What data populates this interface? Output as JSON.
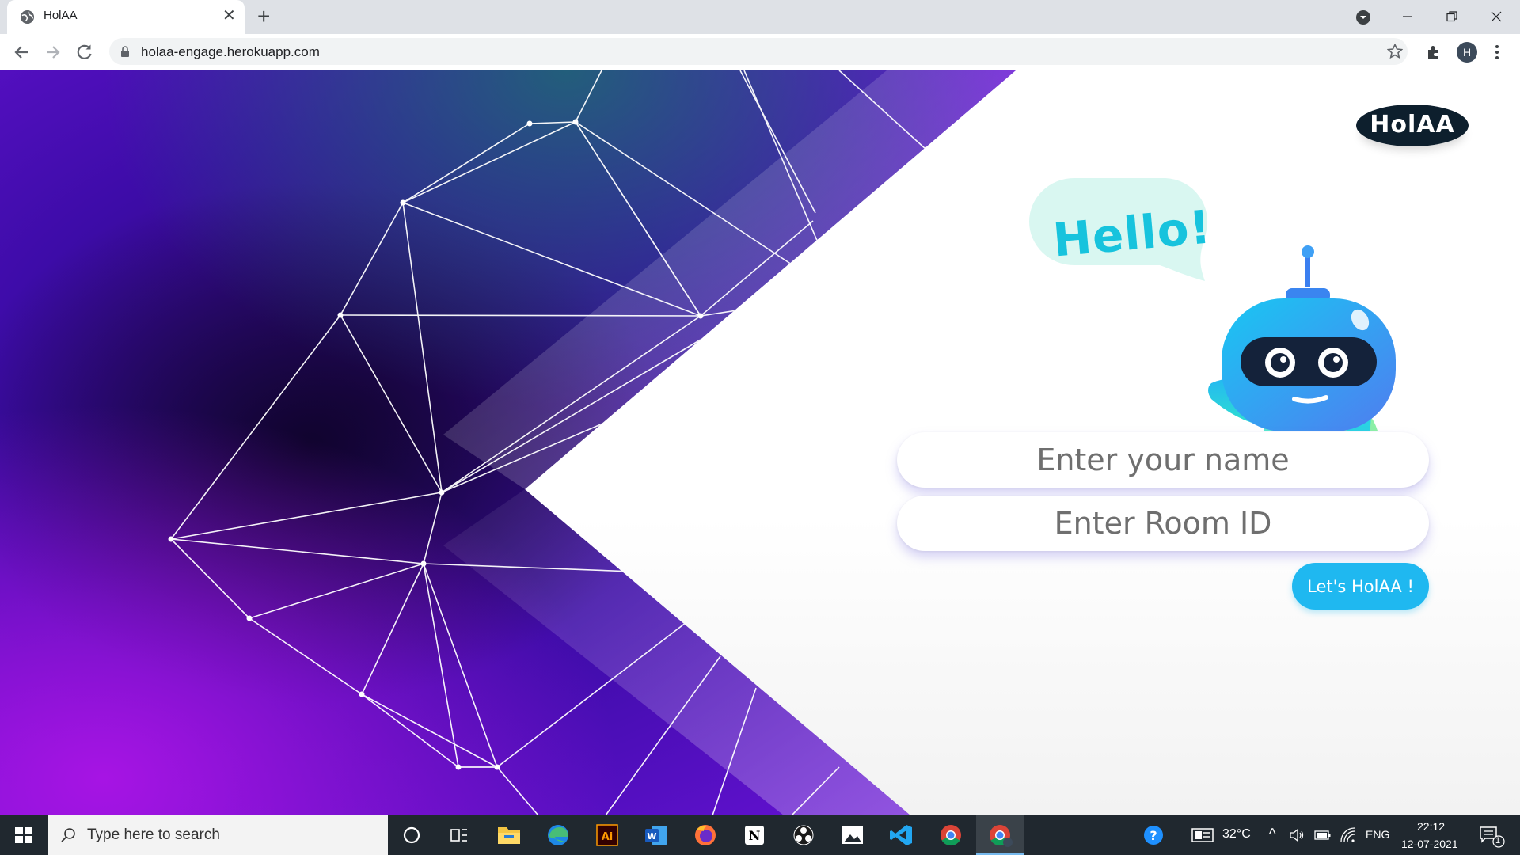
{
  "browser": {
    "tab_title": "HolAA",
    "new_tab_icon": "plus-icon",
    "url": "holaa-engage.herokuapp.com",
    "profile_initial": "H"
  },
  "page": {
    "logo_text": "HolAA",
    "greeting": "Hello!",
    "name_placeholder": "Enter your name",
    "room_placeholder": "Enter Room ID",
    "submit_label": "Let's HolAA !",
    "colors": {
      "accent": "#1fb8f0",
      "hero_purple": "#5a0fc8",
      "hero_dark": "#12062e",
      "robot_blue": "#3fa3f5"
    }
  },
  "taskbar": {
    "search_placeholder": "Type here to search",
    "weather": "32°C",
    "language": "ENG",
    "time": "22:12",
    "date": "12-07-2021",
    "notification_count": "1",
    "pinned_apps": [
      "file-explorer",
      "edge",
      "illustrator",
      "word",
      "firefox",
      "notion",
      "obs",
      "photos",
      "vscode",
      "chrome",
      "chrome-profile"
    ]
  }
}
